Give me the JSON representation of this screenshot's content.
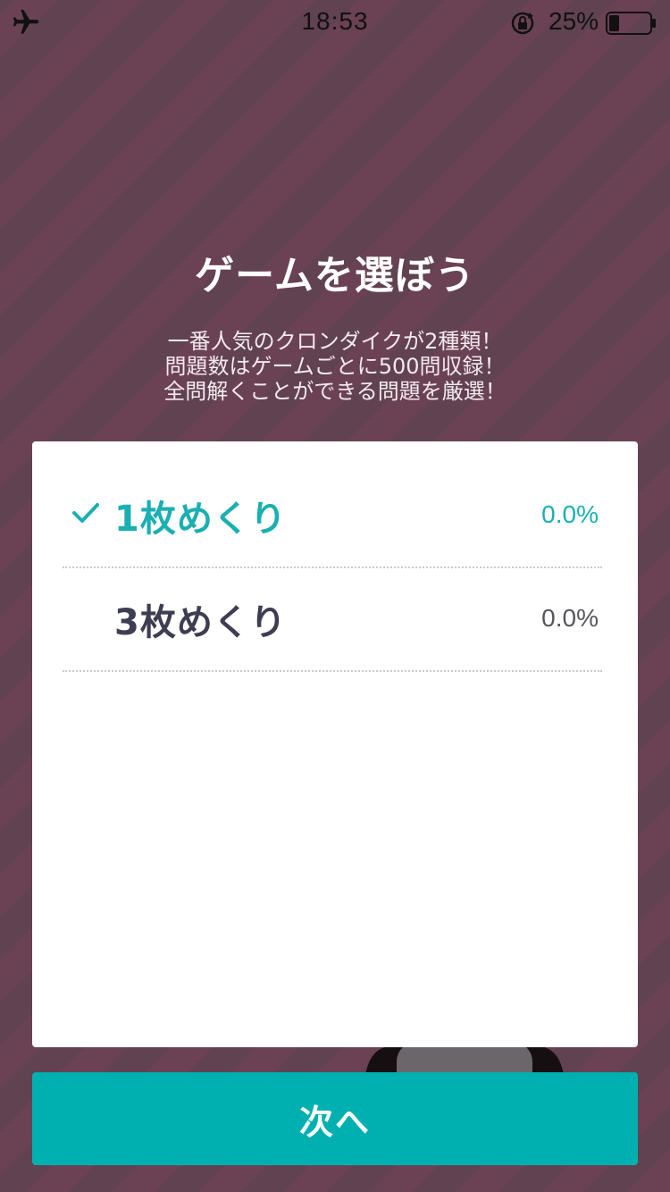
{
  "status_bar": {
    "airplane_icon": "airplane-icon",
    "time": "18:53",
    "rotation_lock_icon": "rotation-lock-icon",
    "battery_percent": "25%",
    "battery_level": 0.25
  },
  "header": {
    "title": "ゲームを選ぼう",
    "description_lines": [
      "一番人気のクロンダイクが2種類！",
      "問題数はゲームごとに500問収録！",
      "全問解くことができる問題を厳選！"
    ]
  },
  "options": [
    {
      "label": "1枚めくり",
      "percent": "0.0%",
      "selected": true
    },
    {
      "label": "3枚めくり",
      "percent": "0.0%",
      "selected": false
    }
  ],
  "next_button": {
    "label": "次へ"
  },
  "colors": {
    "background": "#6a4253",
    "accent": "#1aafb2",
    "button": "#00b0b0",
    "text_dark": "#3e3d52"
  }
}
